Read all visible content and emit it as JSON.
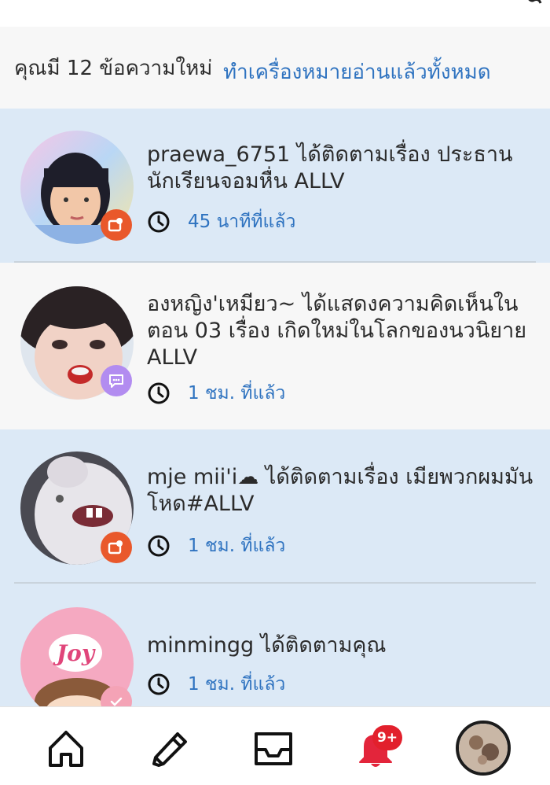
{
  "header": {
    "count_text": "คุณมี 12 ข้อความใหม่",
    "mark_all_label": "ทำเครื่องหมายอ่านแล้วทั้งหมด"
  },
  "notifications": [
    {
      "text": "praewa_6751 ได้ติดตามเรื่อง ประธานนักเรียนจอมหื่น ALLV",
      "time": "45 นาทีที่แล้ว",
      "badge_icon": "follow-icon",
      "state": "unread"
    },
    {
      "text": "องหญิง'เหมียว~ ได้แสดงความคิดเห็นในตอน 03 เรื่อง เกิดใหม่ในโลกของนวนิยาย ALLV",
      "time": "1 ชม. ที่แล้ว",
      "badge_icon": "comment-icon",
      "state": "read"
    },
    {
      "text": "mje mii'i☁ ได้ติดตามเรื่อง เมียพวกผมมันโหด#ALLV",
      "time": "1 ชม. ที่แล้ว",
      "badge_icon": "follow-icon",
      "state": "unread"
    },
    {
      "text": "minmingg ได้ติดตามคุณ",
      "time": "1 ชม. ที่แล้ว",
      "badge_icon": "check-icon",
      "state": "unread",
      "avatar_text": "Joy"
    }
  ],
  "tabbar": {
    "items": [
      "home-icon",
      "pencil-icon",
      "inbox-icon",
      "bell-icon",
      "profile-avatar"
    ],
    "bell_badge": "9+"
  },
  "colors": {
    "accent": "#2f73c0",
    "unread_bg": "#dce9f6",
    "badge_red": "#e2202c",
    "follow_badge": "#e9582b",
    "comment_badge": "#b28cf0"
  }
}
